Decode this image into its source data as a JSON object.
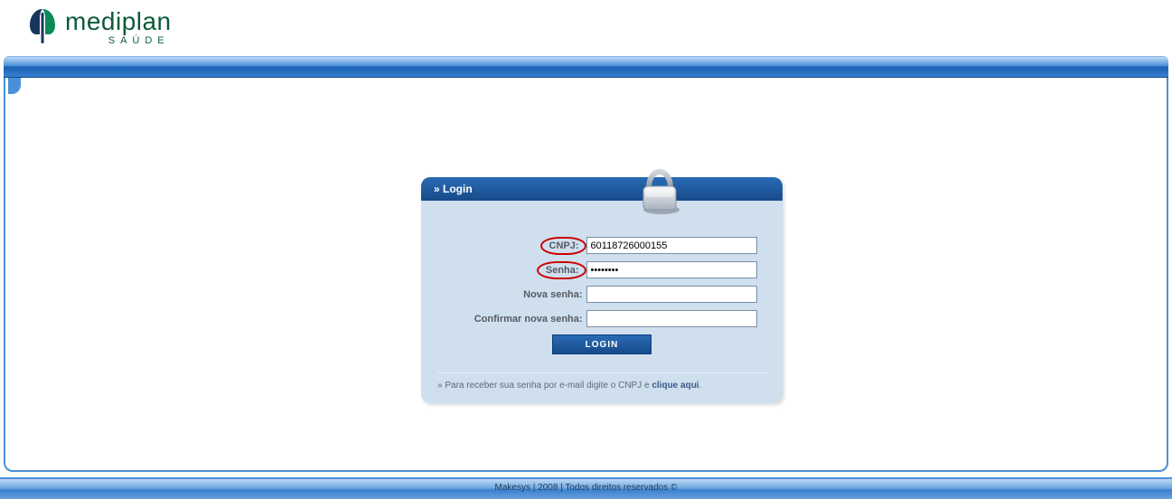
{
  "brand": {
    "name": "mediplan",
    "tagline": "SAÚDE"
  },
  "login": {
    "header": "» Login",
    "labels": {
      "cnpj": "CNPJ:",
      "senha": "Senha:",
      "nova_senha": "Nova senha:",
      "confirmar_nova_senha": "Confirmar nova senha:"
    },
    "values": {
      "cnpj": "60118726000155",
      "senha": "••••••••",
      "nova_senha": "",
      "confirmar_nova_senha": ""
    },
    "button": "LOGIN",
    "help_prefix": "» Para receber sua senha por e-mail digite o CNPJ e ",
    "help_link": "clique aqui",
    "help_suffix": "."
  },
  "footer": {
    "company": "Makesys",
    "sep": " | ",
    "year": "2008",
    "rights": "Todos direitos reservados ©"
  }
}
